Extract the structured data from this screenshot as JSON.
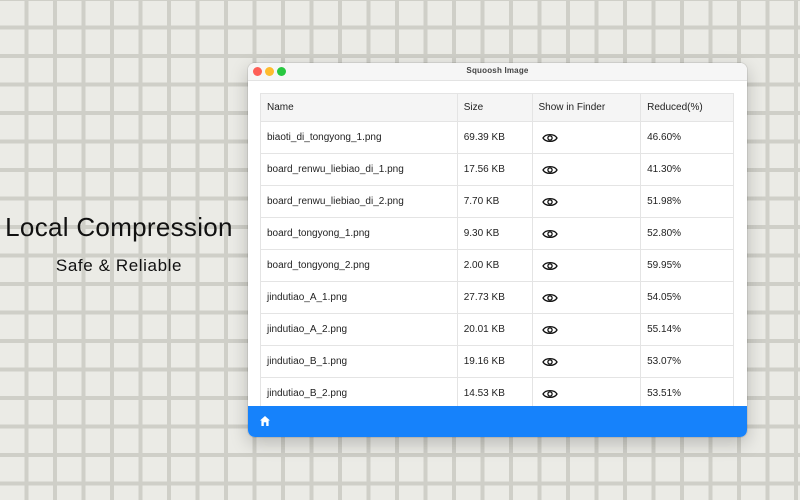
{
  "promo": {
    "headline": "Local Compression",
    "subline": "Safe & Reliable"
  },
  "window": {
    "title": "Squoosh Image"
  },
  "table": {
    "headers": [
      "Name",
      "Size",
      "Show in Finder",
      "Reduced(%)"
    ],
    "rows": [
      {
        "name": "biaoti_di_tongyong_1.png",
        "size": "69.39 KB",
        "reduced": "46.60%"
      },
      {
        "name": "board_renwu_liebiao_di_1.png",
        "size": "17.56 KB",
        "reduced": "41.30%"
      },
      {
        "name": "board_renwu_liebiao_di_2.png",
        "size": "7.70 KB",
        "reduced": "51.98%"
      },
      {
        "name": "board_tongyong_1.png",
        "size": "9.30 KB",
        "reduced": "52.80%"
      },
      {
        "name": "board_tongyong_2.png",
        "size": "2.00 KB",
        "reduced": "59.95%"
      },
      {
        "name": "jindutiao_A_1.png",
        "size": "27.73 KB",
        "reduced": "54.05%"
      },
      {
        "name": "jindutiao_A_2.png",
        "size": "20.01 KB",
        "reduced": "55.14%"
      },
      {
        "name": "jindutiao_B_1.png",
        "size": "19.16 KB",
        "reduced": "53.07%"
      },
      {
        "name": "jindutiao_B_2.png",
        "size": "14.53 KB",
        "reduced": "53.51%"
      }
    ],
    "row_icon": "eye-icon"
  },
  "bottombar": {
    "icon": "home-icon",
    "color": "#1682fb"
  },
  "colors": {
    "close": "#fe5f57",
    "minimize": "#febc2e",
    "zoom": "#28c840"
  }
}
